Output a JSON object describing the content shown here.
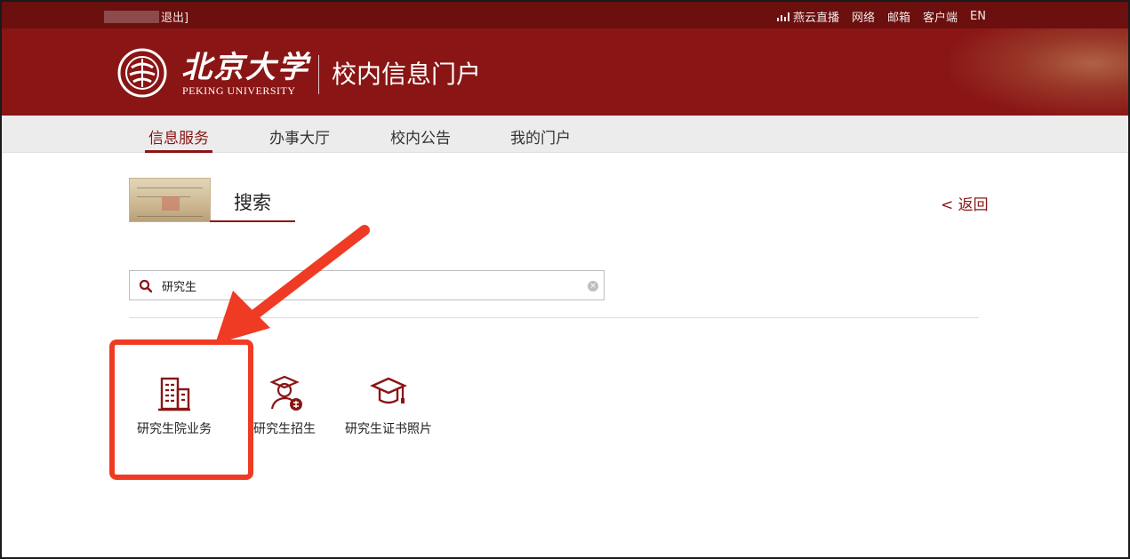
{
  "topbar": {
    "logout_text": "退出]",
    "links": [
      "燕云直播",
      "网络",
      "邮箱",
      "客户端",
      "EN"
    ]
  },
  "header": {
    "school_cn": "北京大学",
    "school_en": "PEKING UNIVERSITY",
    "portal_title": "校内信息门户"
  },
  "nav": {
    "items": [
      "信息服务",
      "办事大厅",
      "校内公告",
      "我的门户"
    ],
    "active_index": 0
  },
  "content": {
    "section_title": "搜索",
    "back_label": "< 返回",
    "search_value": "研究生"
  },
  "results": [
    {
      "label": "研究生院业务",
      "icon": "building-icon"
    },
    {
      "label": "研究生招生",
      "icon": "student-enroll-icon"
    },
    {
      "label": "研究生证书照片",
      "icon": "graduation-cap-icon"
    }
  ],
  "colors": {
    "brand": "#8a1515",
    "topbar": "#6b0f0f",
    "annotation": "#ef3b24"
  }
}
